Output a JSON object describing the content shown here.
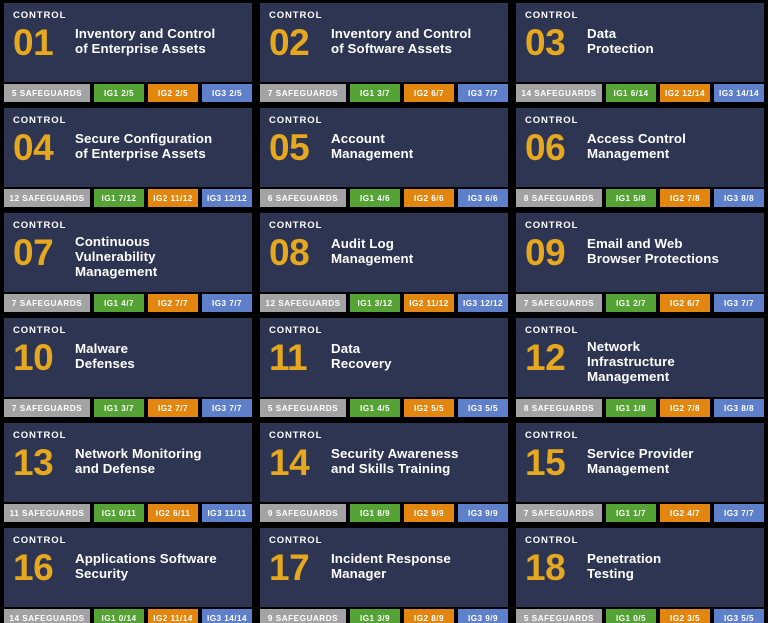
{
  "poster": {
    "eyebrow_label": "CONTROL",
    "safeguards_suffix": "SAFEGUARDS",
    "ig_labels": {
      "ig1": "IG1",
      "ig2": "IG2",
      "ig3": "IG3"
    },
    "colors": {
      "card_background": "#2d3552",
      "page_background": "#000000",
      "number_accent": "#e5a81f",
      "title_text": "#ffffff",
      "safeguards_badge": "#a3a3a3",
      "ig1_badge": "#55a334",
      "ig2_badge": "#e2860f",
      "ig3_badge": "#5e7fc9"
    }
  },
  "controls": [
    {
      "number": "01",
      "eyebrow": "CONTROL",
      "title": "Inventory and Control of Enterprise Assets",
      "title_lines": [
        "Inventory and Control",
        "of Enterprise Assets"
      ],
      "safeguards_count": "5",
      "safeguards_label": "5  SAFEGUARDS",
      "ig1": "IG1  2/5",
      "ig2": "IG2  2/5",
      "ig3": "IG3  2/5"
    },
    {
      "number": "02",
      "eyebrow": "CONTROL",
      "title": "Inventory and Control of Software Assets",
      "title_lines": [
        "Inventory and Control",
        "of Software Assets"
      ],
      "safeguards_count": "7",
      "safeguards_label": "7  SAFEGUARDS",
      "ig1": "IG1  3/7",
      "ig2": "IG2  6/7",
      "ig3": "IG3  7/7"
    },
    {
      "number": "03",
      "eyebrow": "CONTROL",
      "title": "Data Protection",
      "title_lines": [
        "Data",
        "Protection"
      ],
      "safeguards_count": "14",
      "safeguards_label": "14  SAFEGUARDS",
      "ig1": "IG1  6/14",
      "ig2": "IG2  12/14",
      "ig3": "IG3  14/14"
    },
    {
      "number": "04",
      "eyebrow": "CONTROL",
      "title": "Secure Configuration of Enterprise Assets",
      "title_lines": [
        "Secure Configuration",
        "of Enterprise Assets"
      ],
      "safeguards_count": "12",
      "safeguards_label": "12  SAFEGUARDS",
      "ig1": "IG1  7/12",
      "ig2": "IG2  11/12",
      "ig3": "IG3  12/12"
    },
    {
      "number": "05",
      "eyebrow": "CONTROL",
      "title": "Account Management",
      "title_lines": [
        "Account",
        "Management"
      ],
      "safeguards_count": "6",
      "safeguards_label": "6  SAFEGUARDS",
      "ig1": "IG1  4/6",
      "ig2": "IG2  6/6",
      "ig3": "IG3  6/6"
    },
    {
      "number": "06",
      "eyebrow": "CONTROL",
      "title": "Access Control Management",
      "title_lines": [
        "Access Control",
        "Management"
      ],
      "safeguards_count": "8",
      "safeguards_label": "8  SAFEGUARDS",
      "ig1": "IG1  5/8",
      "ig2": "IG2  7/8",
      "ig3": "IG3  8/8"
    },
    {
      "number": "07",
      "eyebrow": "CONTROL",
      "title": "Continuous Vulnerability Management",
      "title_lines": [
        "Continuous",
        "Vulnerability",
        "Management"
      ],
      "safeguards_count": "7",
      "safeguards_label": "7  SAFEGUARDS",
      "ig1": "IG1  4/7",
      "ig2": "IG2  7/7",
      "ig3": "IG3  7/7"
    },
    {
      "number": "08",
      "eyebrow": "CONTROL",
      "title": "Audit Log Management",
      "title_lines": [
        "Audit Log",
        "Management"
      ],
      "safeguards_count": "12",
      "safeguards_label": "12  SAFEGUARDS",
      "ig1": "IG1  3/12",
      "ig2": "IG2  11/12",
      "ig3": "IG3  12/12"
    },
    {
      "number": "09",
      "eyebrow": "CONTROL",
      "title": "Email and Web Browser Protections",
      "title_lines": [
        "Email and Web",
        "Browser Protections"
      ],
      "safeguards_count": "7",
      "safeguards_label": "7  SAFEGUARDS",
      "ig1": "IG1  2/7",
      "ig2": "IG2  6/7",
      "ig3": "IG3  7/7"
    },
    {
      "number": "10",
      "eyebrow": "CONTROL",
      "title": "Malware Defenses",
      "title_lines": [
        "Malware",
        "Defenses"
      ],
      "safeguards_count": "7",
      "safeguards_label": "7  SAFEGUARDS",
      "ig1": "IG1  3/7",
      "ig2": "IG2  7/7",
      "ig3": "IG3  7/7"
    },
    {
      "number": "11",
      "eyebrow": "CONTROL",
      "title": "Data Recovery",
      "title_lines": [
        "Data",
        "Recovery"
      ],
      "safeguards_count": "5",
      "safeguards_label": "5  SAFEGUARDS",
      "ig1": "IG1  4/5",
      "ig2": "IG2  5/5",
      "ig3": "IG3  5/5"
    },
    {
      "number": "12",
      "eyebrow": "CONTROL",
      "title": "Network Infrastructure Management",
      "title_lines": [
        "Network",
        "Infrastructure",
        "Management"
      ],
      "safeguards_count": "8",
      "safeguards_label": "8  SAFEGUARDS",
      "ig1": "IG1  1/8",
      "ig2": "IG2  7/8",
      "ig3": "IG3  8/8"
    },
    {
      "number": "13",
      "eyebrow": "CONTROL",
      "title": "Network Monitoring and Defense",
      "title_lines": [
        "Network Monitoring",
        "and Defense"
      ],
      "safeguards_count": "11",
      "safeguards_label": "11  SAFEGUARDS",
      "ig1": "IG1  0/11",
      "ig2": "IG2  6/11",
      "ig3": "IG3  11/11"
    },
    {
      "number": "14",
      "eyebrow": "CONTROL",
      "title": "Security Awareness and Skills Training",
      "title_lines": [
        "Security Awareness",
        "and Skills Training"
      ],
      "safeguards_count": "9",
      "safeguards_label": "9  SAFEGUARDS",
      "ig1": "IG1  8/9",
      "ig2": "IG2  9/9",
      "ig3": "IG3  9/9"
    },
    {
      "number": "15",
      "eyebrow": "CONTROL",
      "title": "Service Provider Management",
      "title_lines": [
        "Service Provider",
        "Management"
      ],
      "safeguards_count": "7",
      "safeguards_label": "7  SAFEGUARDS",
      "ig1": "IG1  1/7",
      "ig2": "IG2  4/7",
      "ig3": "IG3  7/7"
    },
    {
      "number": "16",
      "eyebrow": "CONTROL",
      "title": "Applications Software Security",
      "title_lines": [
        "Applications Software",
        "Security"
      ],
      "safeguards_count": "14",
      "safeguards_label": "14  SAFEGUARDS",
      "ig1": "IG1 0/14",
      "ig2": "IG2  11/14",
      "ig3": "IG3  14/14"
    },
    {
      "number": "17",
      "eyebrow": "CONTROL",
      "title": "Incident Response Manager",
      "title_lines": [
        "Incident Response",
        "Manager"
      ],
      "safeguards_count": "9",
      "safeguards_label": "9  SAFEGUARDS",
      "ig1": "IG1  3/9",
      "ig2": "IG2  8/9",
      "ig3": "IG3  9/9"
    },
    {
      "number": "18",
      "eyebrow": "CONTROL",
      "title": "Penetration Testing",
      "title_lines": [
        "Penetration",
        "Testing"
      ],
      "safeguards_count": "5",
      "safeguards_label": "5  SAFEGUARDS",
      "ig1": "IG1  0/5",
      "ig2": "IG2  3/5",
      "ig3": "IG3  5/5"
    }
  ]
}
